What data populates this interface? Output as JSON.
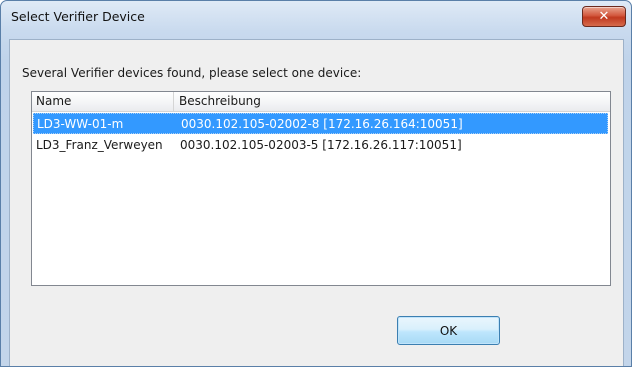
{
  "window": {
    "title": "Select Verifier Device",
    "close_glyph": "✕"
  },
  "dialog": {
    "prompt": "Several Verifier devices found, please select one device:",
    "columns": [
      "Name",
      "Beschreibung"
    ],
    "rows": [
      {
        "name": "LD3-WW-01-m",
        "description": "0030.102.105-02002-8 [172.16.26.164:10051]",
        "selected": true
      },
      {
        "name": "LD3_Franz_Verweyen",
        "description": "0030.102.105-02003-5 [172.16.26.117:10051]",
        "selected": false
      }
    ],
    "ok_label": "OK"
  },
  "colors": {
    "selection": "#3399ff",
    "close_button": "#c7452b"
  }
}
